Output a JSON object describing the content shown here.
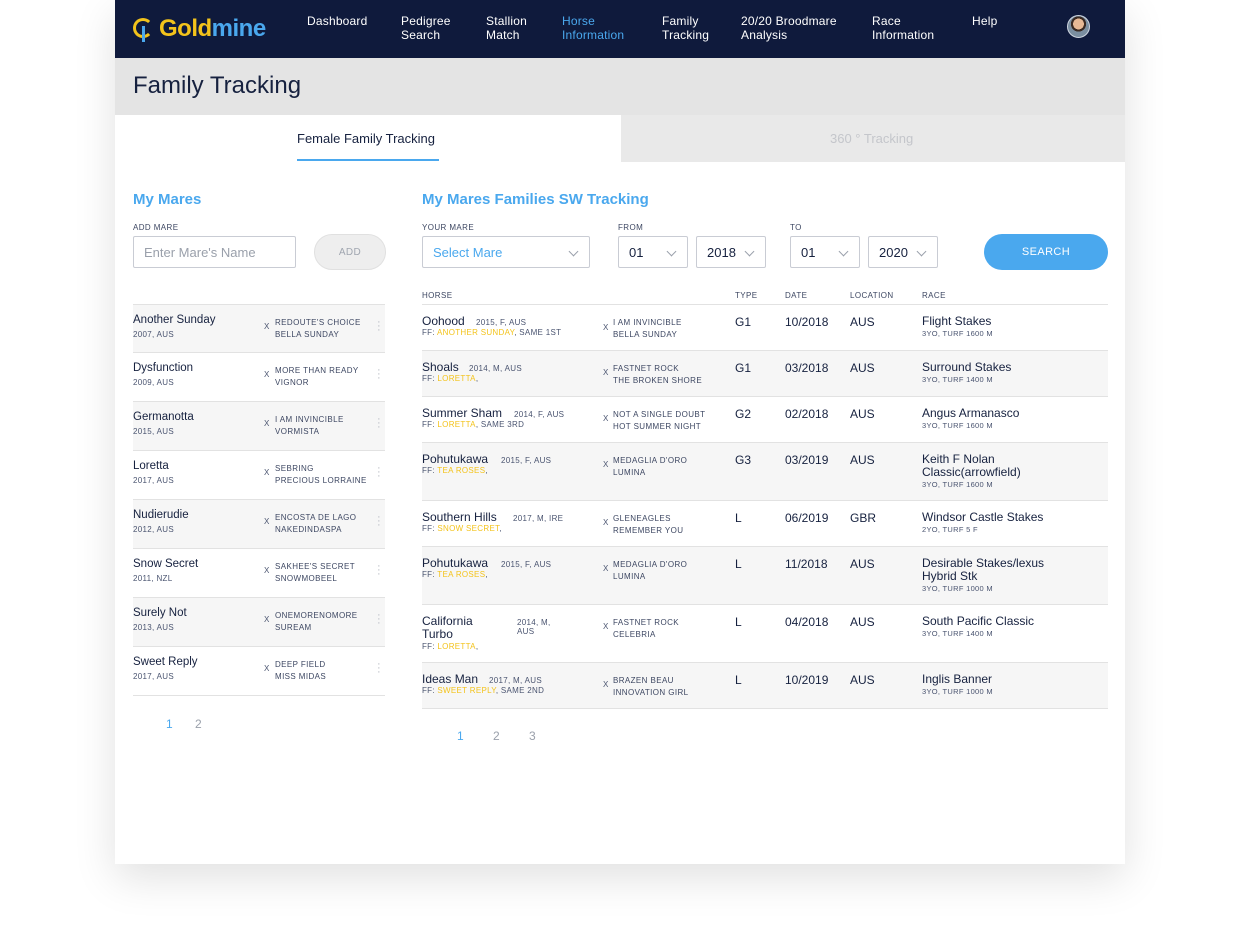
{
  "brand": {
    "logo_gold": "Gold",
    "logo_mine": "mine"
  },
  "nav": [
    {
      "label": "Dashboard",
      "active": false
    },
    {
      "label": "Pedigree\nSearch",
      "active": false
    },
    {
      "label": "Stallion\nMatch",
      "active": false
    },
    {
      "label": "Horse\nInformation",
      "active": true
    },
    {
      "label": "Family\nTracking",
      "active": false
    },
    {
      "label": "20/20 Broodmare\nAnalysis",
      "active": false
    },
    {
      "label": "Race\nInformation",
      "active": false
    },
    {
      "label": "Help",
      "active": false
    }
  ],
  "page": {
    "title": "Family Tracking"
  },
  "tabs": {
    "female": "Female Family Tracking",
    "tracking360": "360 ° Tracking"
  },
  "left": {
    "title": "My Mares",
    "add_label": "ADD MARE",
    "add_placeholder": "Enter Mare's Name",
    "add_button": "ADD",
    "mares": [
      {
        "name": "Another Sunday",
        "meta": "2007, AUS",
        "x": "X",
        "sire": "REDOUTE'S CHOICE",
        "dam": "BELLA SUNDAY"
      },
      {
        "name": "Dysfunction",
        "meta": "2009, AUS",
        "x": "X",
        "sire": "MORE THAN READY",
        "dam": "VIGNOR"
      },
      {
        "name": "Germanotta",
        "meta": "2015, AUS",
        "x": "X",
        "sire": "I AM INVINCIBLE",
        "dam": "VORMISTA"
      },
      {
        "name": "Loretta",
        "meta": "2017, AUS",
        "x": "X",
        "sire": "SEBRING",
        "dam": "PRECIOUS LORRAINE"
      },
      {
        "name": "Nudierudie",
        "meta": "2012, AUS",
        "x": "X",
        "sire": "ENCOSTA DE LAGO",
        "dam": "NAKEDINDASPA"
      },
      {
        "name": "Snow Secret",
        "meta": "2011, NZL",
        "x": "X",
        "sire": "SAKHEE'S SECRET",
        "dam": "SNOWMOBEEL"
      },
      {
        "name": "Surely Not",
        "meta": "2013, AUS",
        "x": "X",
        "sire": "ONEMORENOMORE",
        "dam": "SUREAM"
      },
      {
        "name": "Sweet Reply",
        "meta": "2017, AUS",
        "x": "X",
        "sire": "DEEP FIELD",
        "dam": "MISS MIDAS"
      }
    ],
    "pages": [
      "1",
      "2"
    ]
  },
  "right": {
    "title": "My Mares Families SW Tracking",
    "your_mare_label": "YOUR MARE",
    "your_mare_value": "Select Mare",
    "from_label": "FROM",
    "from_month": "01",
    "from_year": "2018",
    "to_label": "TO",
    "to_month": "01",
    "to_year": "2020",
    "search_button": "SEARCH",
    "columns": {
      "horse": "HORSE",
      "type": "TYPE",
      "date": "DATE",
      "location": "LOCATION",
      "race": "RACE"
    },
    "rows": [
      {
        "name": "Oohood",
        "meta": "2015, F, AUS",
        "ff_prefix": "FF: ",
        "ff_mare": "ANOTHER SUNDAY",
        "ff_suffix": ", SAME 1ST",
        "x": "X",
        "sire": "I AM INVINCIBLE",
        "dam": "BELLA SUNDAY",
        "type": "G1",
        "date": "10/2018",
        "location": "AUS",
        "race": "Flight Stakes",
        "race_meta": "3YO, TURF 1600 M"
      },
      {
        "name": "Shoals",
        "meta": "2014, M, AUS",
        "ff_prefix": "FF: ",
        "ff_mare": "LORETTA",
        "ff_suffix": ",",
        "x": "X",
        "sire": "FASTNET ROCK",
        "dam": "THE BROKEN SHORE",
        "type": "G1",
        "date": "03/2018",
        "location": "AUS",
        "race": "Surround Stakes",
        "race_meta": "3YO, TURF 1400 M"
      },
      {
        "name": "Summer Sham",
        "meta": "2014, F, AUS",
        "ff_prefix": "FF: ",
        "ff_mare": "LORETTA",
        "ff_suffix": ", SAME 3RD",
        "x": "X",
        "sire": "NOT A SINGLE DOUBT",
        "dam": "HOT SUMMER NIGHT",
        "type": "G2",
        "date": "02/2018",
        "location": "AUS",
        "race": "Angus Armanasco",
        "race_meta": "3YO, TURF 1600 M"
      },
      {
        "name": "Pohutukawa",
        "meta": "2015, F, AUS",
        "ff_prefix": "FF: ",
        "ff_mare": "TEA ROSES",
        "ff_suffix": ",",
        "x": "X",
        "sire": "MEDAGLIA D'ORO",
        "dam": "LUMINA",
        "type": "G3",
        "date": "03/2019",
        "location": "AUS",
        "race": "Keith F Nolan Classic(arrowfield)",
        "race_meta": "3YO, TURF 1600 M"
      },
      {
        "name": "Southern Hills",
        "meta": "2017, M, IRE",
        "ff_prefix": "FF: ",
        "ff_mare": "SNOW SECRET",
        "ff_suffix": ",",
        "x": "X",
        "sire": "GLENEAGLES",
        "dam": "REMEMBER YOU",
        "type": "L",
        "date": "06/2019",
        "location": "GBR",
        "race": "Windsor Castle Stakes",
        "race_meta": "2YO, TURF 5 F"
      },
      {
        "name": "Pohutukawa",
        "meta": "2015, F, AUS",
        "ff_prefix": "FF: ",
        "ff_mare": "TEA ROSES",
        "ff_suffix": ",",
        "x": "X",
        "sire": "MEDAGLIA D'ORO",
        "dam": "LUMINA",
        "type": "L",
        "date": "11/2018",
        "location": "AUS",
        "race": "Desirable Stakes/lexus Hybrid Stk",
        "race_meta": "3YO, TURF 1000 M"
      },
      {
        "name": "California Turbo",
        "meta": "2014, M, AUS",
        "ff_prefix": "FF: ",
        "ff_mare": "LORETTA",
        "ff_suffix": ",",
        "x": "X",
        "sire": "FASTNET ROCK",
        "dam": "CELEBRIA",
        "type": "L",
        "date": "04/2018",
        "location": "AUS",
        "race": "South Pacific Classic",
        "race_meta": "3YO, TURF 1400 M"
      },
      {
        "name": "Ideas Man",
        "meta": "2017, M, AUS",
        "ff_prefix": "FF: ",
        "ff_mare": "SWEET REPLY",
        "ff_suffix": ", SAME 2ND",
        "x": "X",
        "sire": "BRAZEN BEAU",
        "dam": "INNOVATION GIRL",
        "type": "L",
        "date": "10/2019",
        "location": "AUS",
        "race": "Inglis Banner",
        "race_meta": "3YO, TURF 1000 M"
      }
    ],
    "pages": [
      "1",
      "2",
      "3"
    ]
  }
}
